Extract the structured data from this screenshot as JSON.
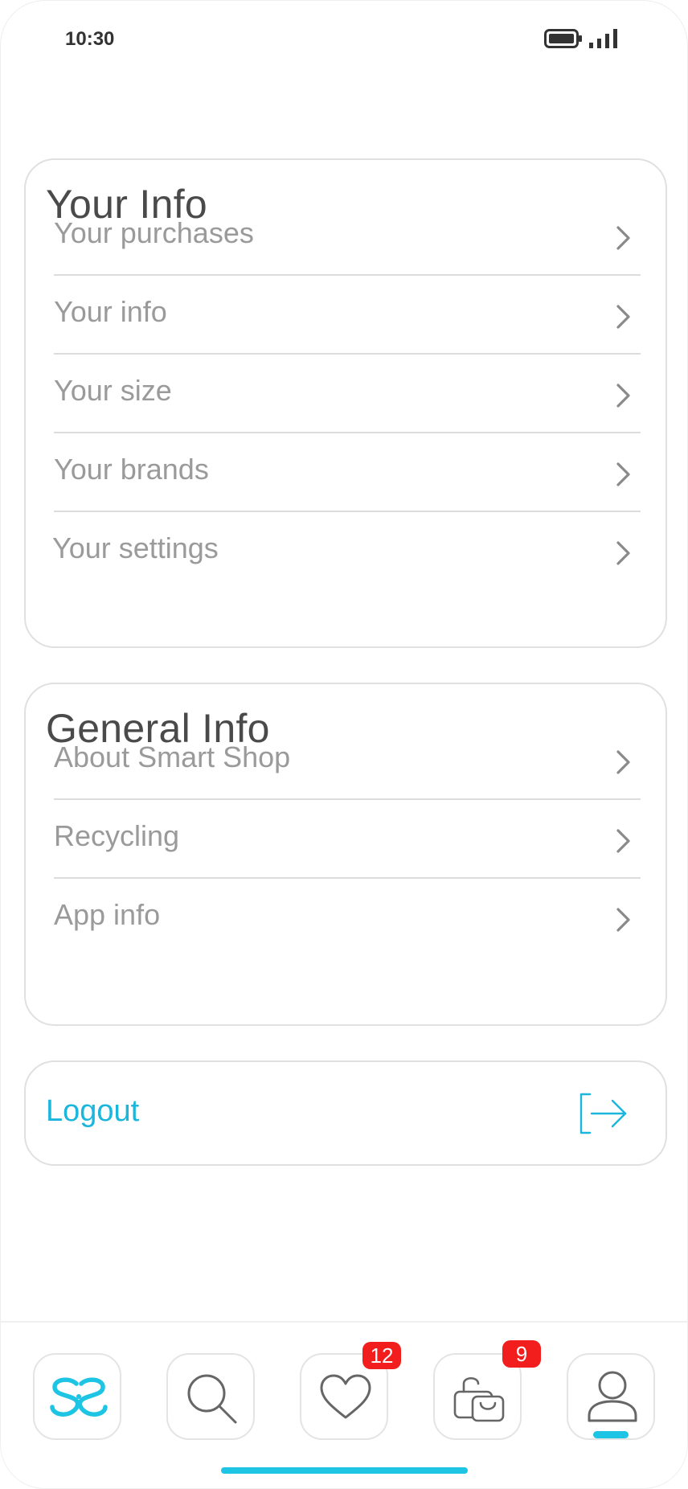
{
  "status_bar": {
    "time": "10:30",
    "battery_icon": "battery-icon",
    "signal_icon": "signal-icon"
  },
  "your_info": {
    "title": "Your Info",
    "items": [
      {
        "label": "Your purchases"
      },
      {
        "label": "Your info"
      },
      {
        "label": "Your size"
      },
      {
        "label": "Your brands"
      },
      {
        "label": "Your settings"
      }
    ]
  },
  "general_info": {
    "title": "General Info",
    "items": [
      {
        "label": "About Smart Shop"
      },
      {
        "label": "Recycling"
      },
      {
        "label": "App info"
      }
    ]
  },
  "logout": {
    "label": "Logout",
    "icon": "logout-icon"
  },
  "bottom_nav": {
    "items": [
      {
        "name": "home",
        "icon": "smart-shop-logo-icon"
      },
      {
        "name": "search",
        "icon": "search-icon"
      },
      {
        "name": "favorites",
        "icon": "heart-icon",
        "badge": "12"
      },
      {
        "name": "bag",
        "icon": "shopping-bag-icon",
        "badge": "9"
      },
      {
        "name": "profile",
        "icon": "user-icon",
        "active": true
      }
    ]
  },
  "colors": {
    "accent": "#1ab6dc",
    "badge": "#f21e1e",
    "title_text": "#4a4a4a",
    "item_text": "#9a9a9a",
    "border": "#e0e0e0"
  }
}
